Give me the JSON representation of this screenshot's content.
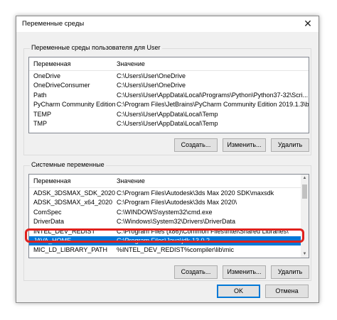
{
  "window": {
    "title": "Переменные среды",
    "close_glyph": "✕"
  },
  "user_section": {
    "label": "Переменные среды пользователя для User",
    "columns": [
      "Переменная",
      "Значение"
    ],
    "rows": [
      {
        "name": "OneDrive",
        "value": "C:\\Users\\User\\OneDrive"
      },
      {
        "name": "OneDriveConsumer",
        "value": "C:\\Users\\User\\OneDrive"
      },
      {
        "name": "Path",
        "value": "C:\\Users\\User\\AppData\\Local\\Programs\\Python\\Python37-32\\Scri..."
      },
      {
        "name": "PyCharm Community Edition",
        "value": "C:\\Program Files\\JetBrains\\PyCharm Community Edition 2019.1.3\\b..."
      },
      {
        "name": "TEMP",
        "value": "C:\\Users\\User\\AppData\\Local\\Temp"
      },
      {
        "name": "TMP",
        "value": "C:\\Users\\User\\AppData\\Local\\Temp"
      }
    ],
    "buttons": {
      "create": "Создать...",
      "edit": "Изменить...",
      "delete": "Удалить"
    }
  },
  "system_section": {
    "label": "Системные переменные",
    "columns": [
      "Переменная",
      "Значение"
    ],
    "rows": [
      {
        "name": "ADSK_3DSMAX_SDK_2020",
        "value": "C:\\Program Files\\Autodesk\\3ds Max 2020 SDK\\maxsdk"
      },
      {
        "name": "ADSK_3DSMAX_x64_2020",
        "value": "C:\\Program Files\\Autodesk\\3ds Max 2020\\"
      },
      {
        "name": "ComSpec",
        "value": "C:\\WINDOWS\\system32\\cmd.exe"
      },
      {
        "name": "DriverData",
        "value": "C:\\Windows\\System32\\Drivers\\DriverData"
      },
      {
        "name": "INTEL_DEV_REDIST",
        "value": "C:\\Program Files (x86)\\Common Files\\Intel\\Shared Libraries\\"
      },
      {
        "name": "JAVA_HOME",
        "value": "C:\\Program Files\\Java\\jdk-13.0.2"
      },
      {
        "name": "MIC_LD_LIBRARY_PATH",
        "value": "%INTEL_DEV_REDIST%compiler\\lib\\mic"
      }
    ],
    "selected_index": 5,
    "buttons": {
      "create": "Создать...",
      "edit": "Изменить...",
      "delete": "Удалить"
    }
  },
  "footer": {
    "ok": "OK",
    "cancel": "Отмена"
  },
  "colors": {
    "selection": "#0078d7",
    "highlight": "#e0201c"
  }
}
